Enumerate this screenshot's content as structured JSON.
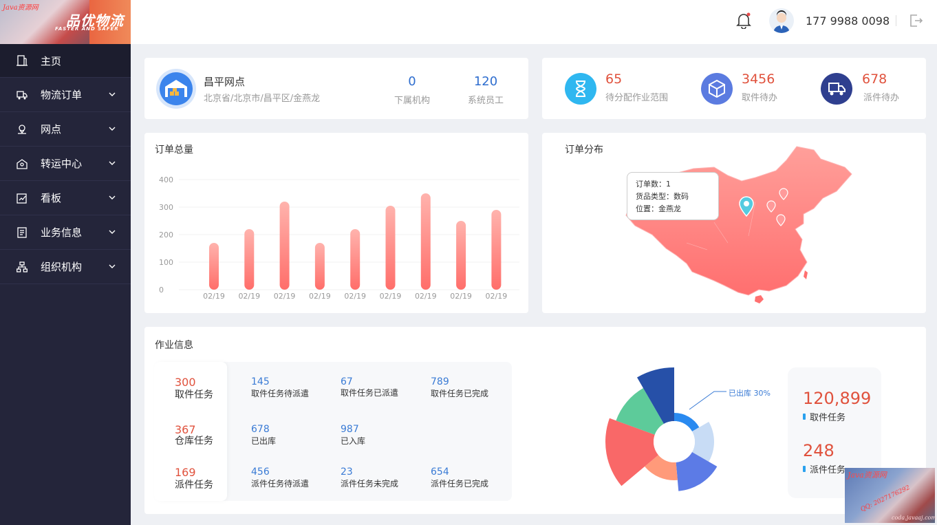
{
  "brand": {
    "name": "品优物流",
    "slogan": "FASTER AND SAFER",
    "watermark": "Java资源网",
    "watermark_qq": "QQ: 2027176292",
    "watermark_site": "coda.javaaj.com"
  },
  "sidebar": {
    "items": [
      {
        "label": "主页",
        "icon": "home-icon",
        "active": true
      },
      {
        "label": "物流订单",
        "icon": "truck-icon"
      },
      {
        "label": "网点",
        "icon": "location-icon"
      },
      {
        "label": "转运中心",
        "icon": "warehouse-icon"
      },
      {
        "label": "看板",
        "icon": "chart-board-icon"
      },
      {
        "label": "业务信息",
        "icon": "document-icon"
      },
      {
        "label": "组织机构",
        "icon": "org-chart-icon"
      }
    ]
  },
  "header": {
    "phone": "177 9988 0098"
  },
  "site": {
    "name": "昌平网点",
    "address": "北京省/北京市/昌平区/金燕龙",
    "stats": [
      {
        "value": "0",
        "label": "下属机构"
      },
      {
        "value": "120",
        "label": "系统员工"
      }
    ]
  },
  "todos": [
    {
      "value": "65",
      "label": "待分配作业范围",
      "icon": "hourglass-icon",
      "color": "#2fb7f0"
    },
    {
      "value": "3456",
      "label": "取件待办",
      "icon": "package-icon",
      "color": "#5b7be0"
    },
    {
      "value": "678",
      "label": "派件待办",
      "icon": "delivery-truck-icon",
      "color": "#2f3f8f"
    }
  ],
  "orders_chart": {
    "title": "订单总量",
    "chart_data": {
      "type": "bar",
      "categories": [
        "02/19",
        "02/19",
        "02/19",
        "02/19",
        "02/19",
        "02/19",
        "02/19",
        "02/19",
        "02/19"
      ],
      "values": [
        170,
        220,
        320,
        170,
        220,
        305,
        350,
        250,
        290
      ],
      "yticks": [
        0,
        100,
        200,
        300,
        400
      ],
      "ylim": [
        0,
        400
      ]
    }
  },
  "map": {
    "title": "订单分布",
    "tooltip": {
      "line1": "订单数：1",
      "line2": "货品类型：数码",
      "line3": "位置：金燕龙"
    }
  },
  "tasks": {
    "title": "作业信息",
    "rows": [
      {
        "value": "300",
        "label": "取件任务",
        "items": [
          {
            "value": "145",
            "label": "取件任务待派遣"
          },
          {
            "value": "67",
            "label": "取件任务已派遣"
          },
          {
            "value": "789",
            "label": "取件任务已完成"
          }
        ]
      },
      {
        "value": "367",
        "label": "仓库任务",
        "items": [
          {
            "value": "678",
            "label": "已出库"
          },
          {
            "value": "987",
            "label": "已入库"
          }
        ]
      },
      {
        "value": "169",
        "label": "派件任务",
        "items": [
          {
            "value": "456",
            "label": "派件任务待派遣"
          },
          {
            "value": "23",
            "label": "派件任务未完成"
          },
          {
            "value": "654",
            "label": "派件任务已完成"
          }
        ]
      }
    ],
    "rose_chart": {
      "type": "pie",
      "callout": "已出库  30%",
      "segments": [
        {
          "color": "#2a8af0",
          "start": 0,
          "end": 60,
          "r": 42
        },
        {
          "color": "#c8dcf5",
          "start": 60,
          "end": 120,
          "r": 58
        },
        {
          "color": "#5c7be6",
          "start": 120,
          "end": 175,
          "r": 72
        },
        {
          "color": "#ff9a7a",
          "start": 175,
          "end": 230,
          "r": 56
        },
        {
          "color": "#f96868",
          "start": 230,
          "end": 290,
          "r": 100
        },
        {
          "color": "#5dcb9a",
          "start": 290,
          "end": 330,
          "r": 90
        },
        {
          "color": "#2650a8",
          "start": 330,
          "end": 360,
          "r": 108
        }
      ]
    },
    "summary": [
      {
        "value": "120,899",
        "label": "取件任务"
      },
      {
        "value": "248",
        "label": "派件任务"
      }
    ]
  }
}
